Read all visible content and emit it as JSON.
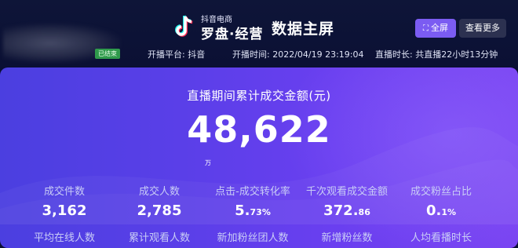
{
  "header": {
    "logo_small": "抖音电商",
    "logo_big": "罗盘·经营",
    "page_title": "数据主屏",
    "fullscreen_label": "全屏",
    "more_label": "查看更多",
    "status_badge": "已结束",
    "platform": "开播平台: 抖音",
    "start_time": "开播时间: 2022/04/19 23:19:04",
    "duration": "直播时长: 共直播22小时13分钟"
  },
  "kpi": {
    "label": "直播期间累计成交金额(元)",
    "value": "48,622",
    "unit": "万"
  },
  "stats": [
    {
      "label": "成交件数",
      "value": "3,162",
      "dec": ""
    },
    {
      "label": "成交人数",
      "value": "2,785",
      "dec": ""
    },
    {
      "label": "点击-成交转化率",
      "value": "5.",
      "dec": "73%"
    },
    {
      "label": "千次观看成交金额",
      "value": "372.",
      "dec": "86"
    },
    {
      "label": "成交粉丝占比",
      "value": "0.",
      "dec": "1%"
    }
  ],
  "stats_row2": [
    {
      "label": "平均在线人数"
    },
    {
      "label": "累计观看人数"
    },
    {
      "label": "新加粉丝团人数"
    },
    {
      "label": "新增粉丝数"
    },
    {
      "label": "人均看播时长"
    }
  ],
  "colors": {
    "background": "#0a0f33",
    "panel_start": "#4b3fe0",
    "panel_end": "#7a44f2",
    "accent_button": "#7b5cf2",
    "status_green": "#2f9a4b"
  },
  "icons": [
    "douyin-logo-icon",
    "fullscreen-icon"
  ]
}
